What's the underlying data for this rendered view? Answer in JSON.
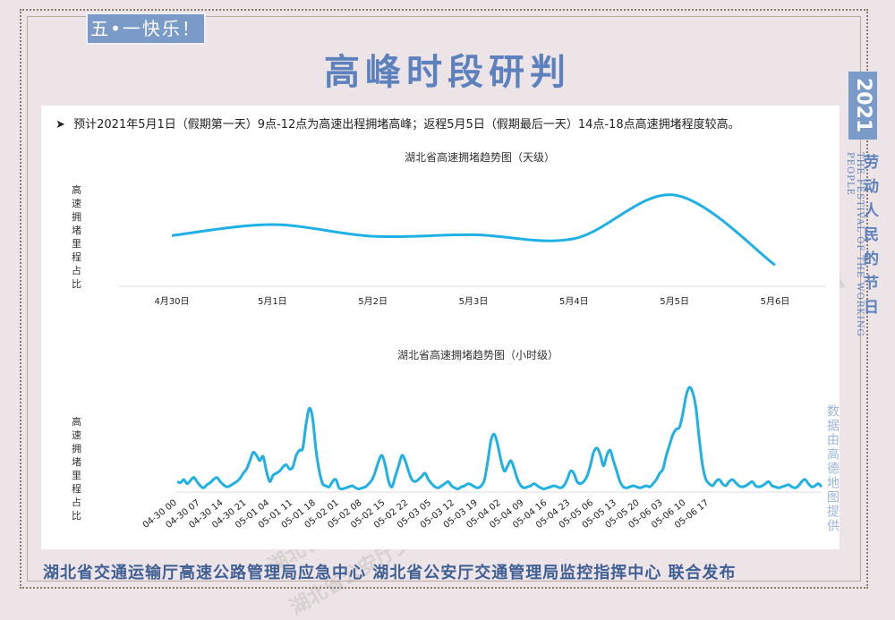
{
  "badge": "五•一快乐！",
  "title": "高峰时段研判",
  "note": "预计2021年5月1日（假期第一天）9点-12点为高速出程拥堵高峰；返程5月5日（假期最后一天）14点-18点高速拥堵程度较高。",
  "note_icon": "arrow-bullet-icon",
  "side": {
    "year": "2021",
    "english": "THE FESTIVAL OF THE WORKING PEOPLE",
    "festival": "劳动人民的节日",
    "source": "数据由高德地图提供"
  },
  "footer": "湖北省交通运输厅高速公路管理局应急中心 湖北省公安厅交通管理局监控指挥中心 联合发布",
  "watermarks": [
    "湖北省高速公路管理局应急中心",
    "湖北省公安厅交通管理局监控指挥中心",
    "湖北",
    "湖北省"
  ],
  "colors": {
    "line": "#1fb0e6",
    "accent": "#5c81bd",
    "badge": "#7a9ac7"
  },
  "chart_data": [
    {
      "type": "line",
      "title": "湖北省高速拥堵趋势图（天级）",
      "ylabel": "高速拥堵里程占比",
      "categories": [
        "4月30日",
        "5月1日",
        "5月2日",
        "5月3日",
        "5月4日",
        "5月5日",
        "5月6日"
      ],
      "x": [
        0,
        1,
        2,
        3,
        4,
        5,
        6
      ],
      "values": [
        0.48,
        0.62,
        0.47,
        0.49,
        0.44,
        1.0,
        0.1
      ],
      "ylim": [
        0,
        1.1
      ],
      "grid": false
    },
    {
      "type": "line",
      "title": "湖北省高速拥堵趋势图（小时级）",
      "ylabel": "高速拥堵里程占比",
      "x_tick_labels": [
        "04-30 00",
        "04-30 07",
        "04-30 14",
        "04-30 21",
        "05-01 04",
        "05-01 11",
        "05-01 18",
        "05-02 01",
        "05-02 08",
        "05-02 15",
        "05-02 22",
        "05-03 05",
        "05-03 12",
        "05-03 19",
        "05-04 02",
        "05-04 09",
        "05-04 16",
        "05-04 23",
        "05-05 06",
        "05-05 13",
        "05-05 20",
        "05-06 03",
        "05-06 10",
        "05-06 17"
      ],
      "values": [
        0.1,
        0.09,
        0.12,
        0.08,
        0.11,
        0.14,
        0.1,
        0.06,
        0.04,
        0.07,
        0.09,
        0.12,
        0.14,
        0.1,
        0.07,
        0.05,
        0.06,
        0.08,
        0.1,
        0.13,
        0.18,
        0.22,
        0.3,
        0.38,
        0.35,
        0.3,
        0.34,
        0.2,
        0.1,
        0.16,
        0.18,
        0.2,
        0.24,
        0.26,
        0.22,
        0.24,
        0.35,
        0.4,
        0.42,
        0.65,
        0.8,
        0.7,
        0.4,
        0.2,
        0.08,
        0.06,
        0.05,
        0.1,
        0.12,
        0.04,
        0.03,
        0.04,
        0.05,
        0.06,
        0.04,
        0.03,
        0.04,
        0.05,
        0.08,
        0.12,
        0.2,
        0.3,
        0.35,
        0.25,
        0.1,
        0.05,
        0.15,
        0.25,
        0.35,
        0.3,
        0.2,
        0.12,
        0.1,
        0.12,
        0.15,
        0.18,
        0.12,
        0.08,
        0.05,
        0.04,
        0.06,
        0.08,
        0.1,
        0.06,
        0.04,
        0.03,
        0.05,
        0.06,
        0.08,
        0.07,
        0.05,
        0.04,
        0.06,
        0.12,
        0.3,
        0.5,
        0.55,
        0.45,
        0.3,
        0.2,
        0.25,
        0.3,
        0.22,
        0.12,
        0.06,
        0.04,
        0.05,
        0.06,
        0.08,
        0.06,
        0.04,
        0.03,
        0.04,
        0.05,
        0.06,
        0.05,
        0.04,
        0.06,
        0.12,
        0.2,
        0.18,
        0.1,
        0.08,
        0.1,
        0.15,
        0.25,
        0.38,
        0.42,
        0.36,
        0.25,
        0.35,
        0.4,
        0.3,
        0.2,
        0.1,
        0.05,
        0.04,
        0.05,
        0.06,
        0.05,
        0.04,
        0.05,
        0.06,
        0.05,
        0.08,
        0.12,
        0.18,
        0.22,
        0.35,
        0.45,
        0.55,
        0.6,
        0.62,
        0.75,
        0.92,
        1.0,
        0.95,
        0.8,
        0.5,
        0.25,
        0.12,
        0.08,
        0.06,
        0.1,
        0.12,
        0.08,
        0.06,
        0.1,
        0.12,
        0.09,
        0.06,
        0.05,
        0.06,
        0.08,
        0.1,
        0.06,
        0.05,
        0.06,
        0.08,
        0.1,
        0.06,
        0.05,
        0.04,
        0.05,
        0.06,
        0.07,
        0.05,
        0.04,
        0.06,
        0.1,
        0.12,
        0.08,
        0.05,
        0.06,
        0.08,
        0.05
      ],
      "ylim": [
        0,
        1.1
      ],
      "grid": false
    }
  ]
}
